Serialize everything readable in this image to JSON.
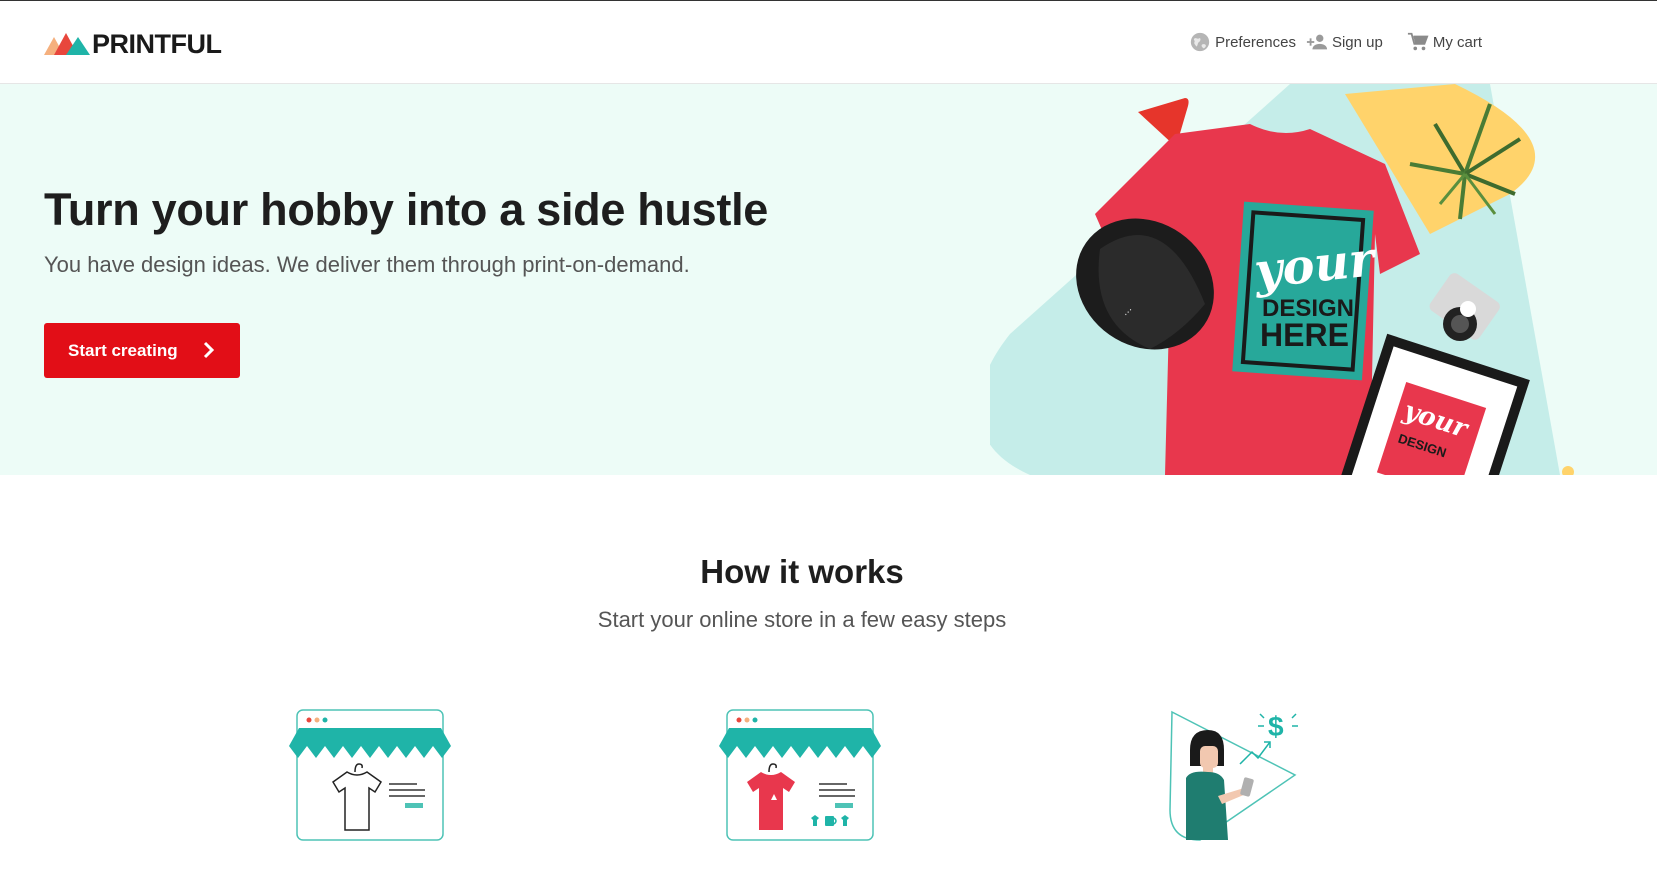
{
  "header": {
    "logo_text": "PRINTFUL",
    "nav": {
      "preferences": "Preferences",
      "signup": "Sign up",
      "cart": "My cart"
    }
  },
  "hero": {
    "title": "Turn your hobby into a side hustle",
    "subtitle": "You have design ideas. We deliver them through print-on-demand.",
    "cta_label": "Start creating",
    "shirt_text_1": "your",
    "shirt_text_2": "DESIGN",
    "shirt_text_3": "HERE",
    "frame_text_1": "your",
    "frame_text_2": "DESIGN"
  },
  "how_it_works": {
    "title": "How it works",
    "subtitle": "Start your online store in a few easy steps",
    "steps": [
      {
        "icon": "store-blank-tshirt-icon"
      },
      {
        "icon": "store-red-tshirt-icon"
      },
      {
        "icon": "woman-earning-money-icon",
        "symbol": "$"
      }
    ]
  },
  "colors": {
    "brand_red": "#e20e17",
    "teal": "#26b3a8",
    "hero_bg": "#edfcf7",
    "light_teal": "#c5ede9",
    "yellow": "#ffd36b"
  }
}
